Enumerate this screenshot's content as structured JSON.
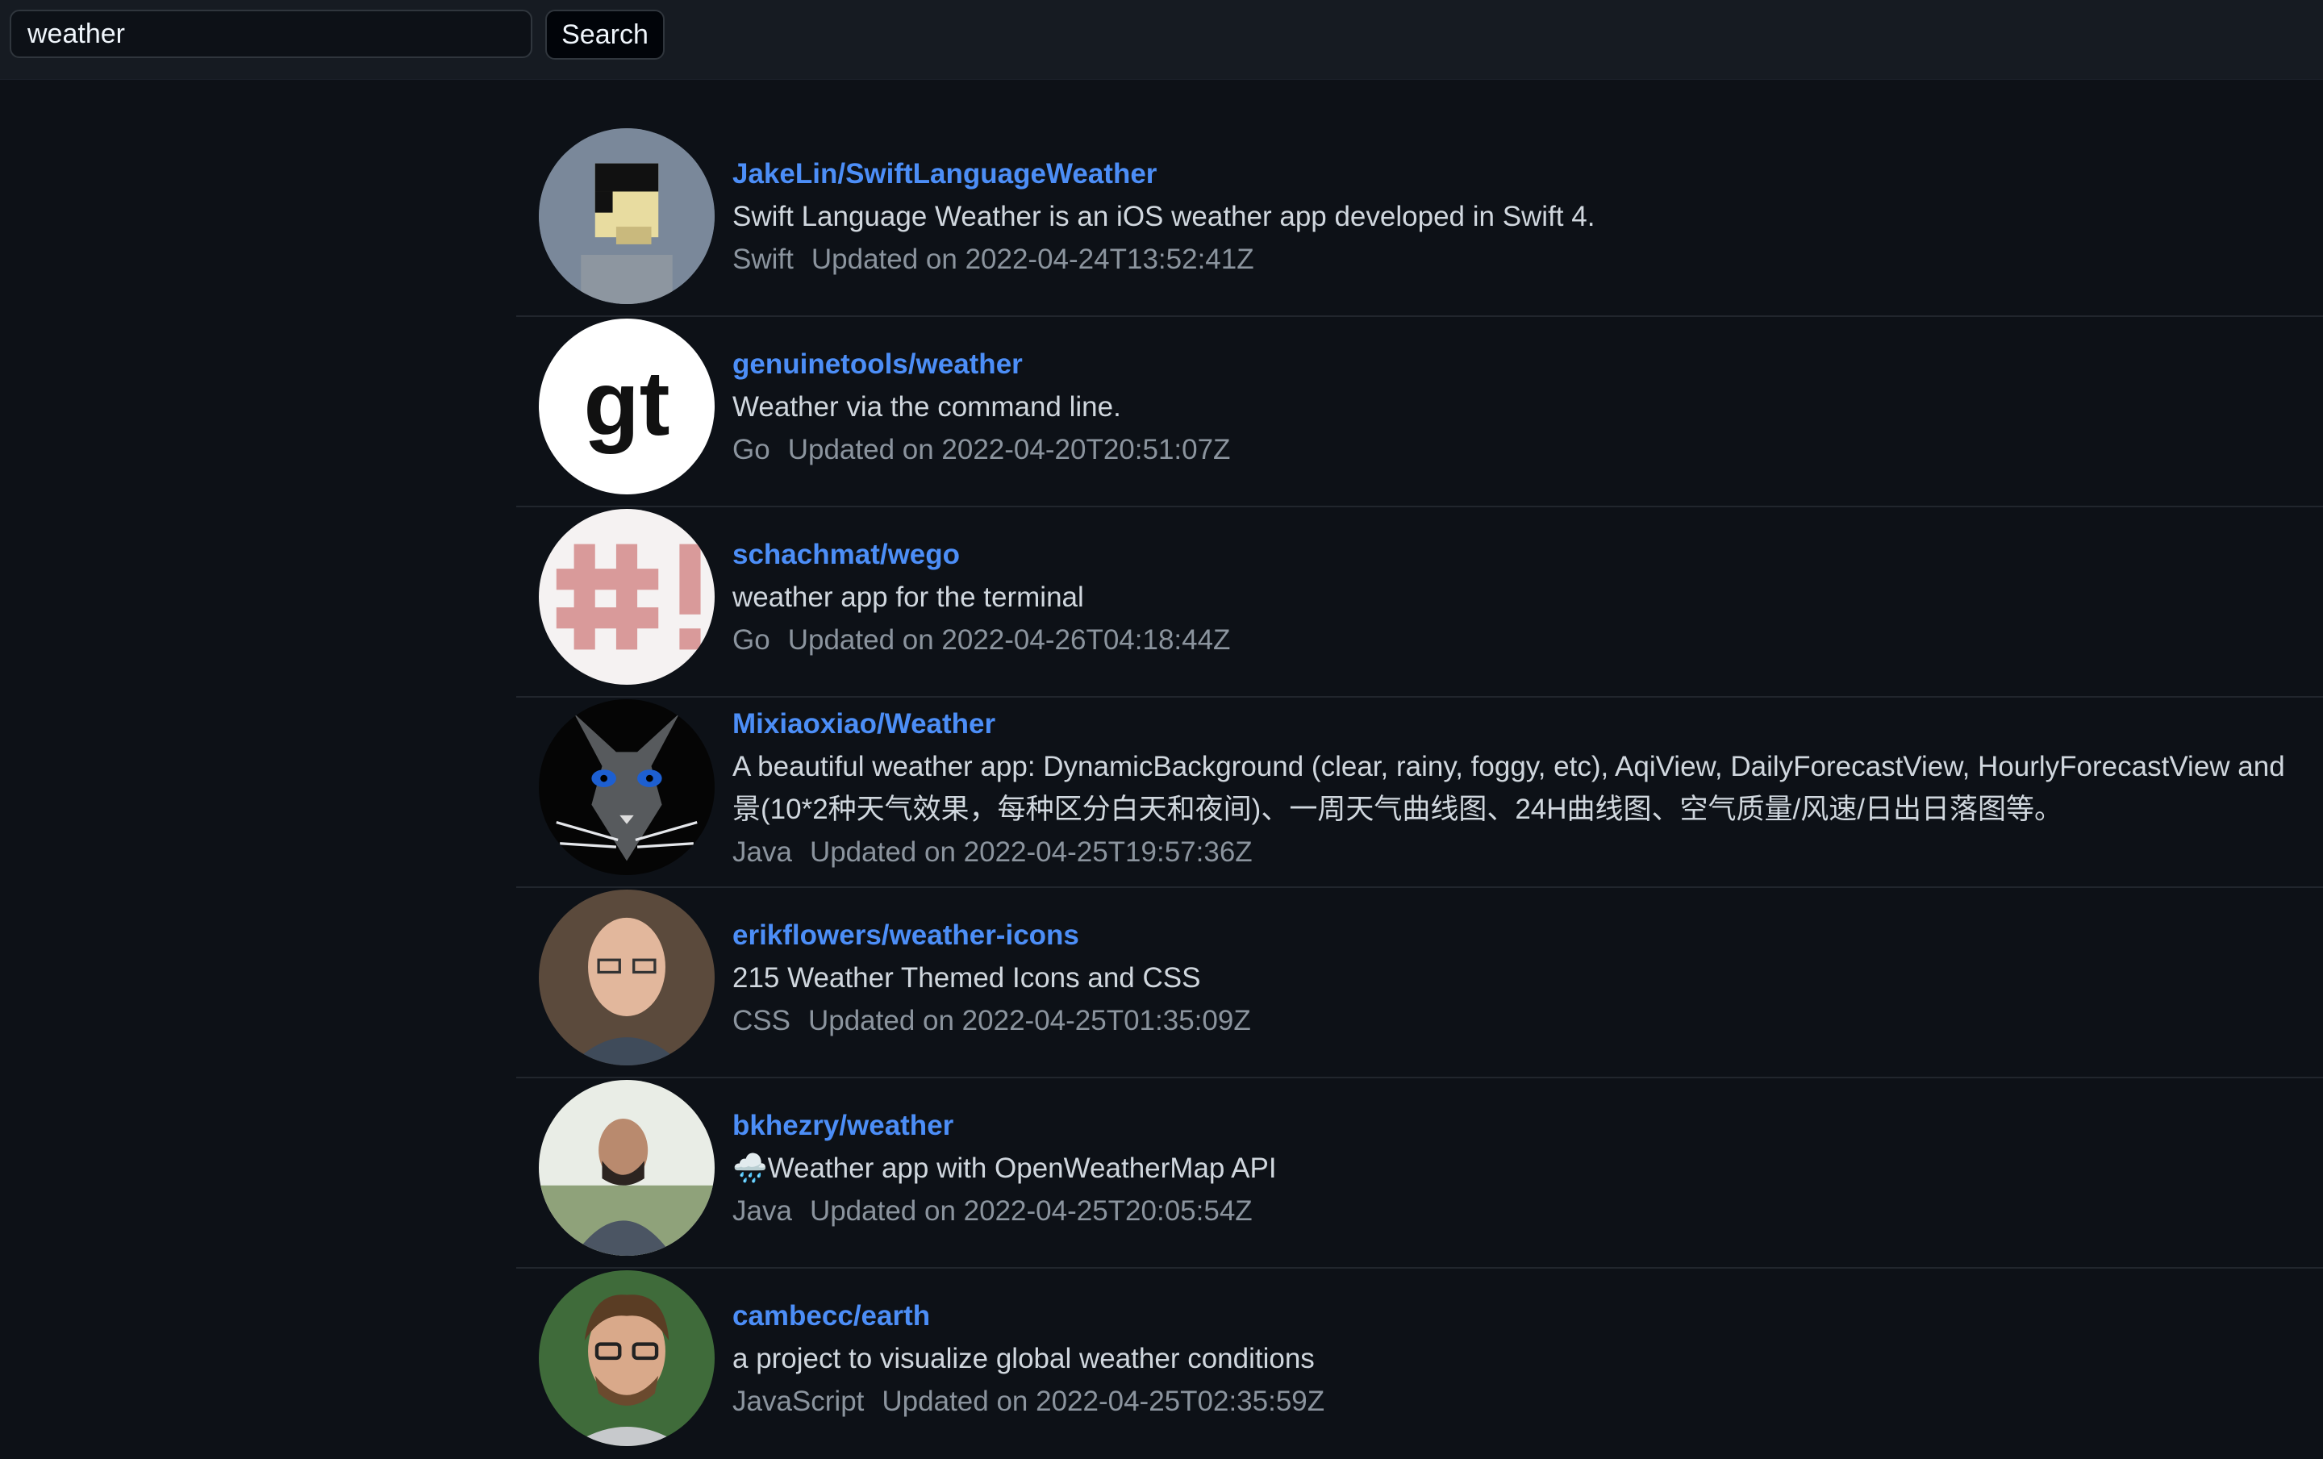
{
  "search": {
    "value": "weather",
    "button_label": "Search"
  },
  "results": [
    {
      "name": "JakeLin/SwiftLanguageWeather",
      "description": "Swift Language Weather is an iOS weather app developed in Swift 4.",
      "language": "Swift",
      "updated": "Updated on 2022-04-24T13:52:41Z",
      "avatar": "pixel-person-avatar"
    },
    {
      "name": "genuinetools/weather",
      "description": "Weather via the command line.",
      "language": "Go",
      "updated": "Updated on 2022-04-20T20:51:07Z",
      "avatar": "gt-logo-avatar",
      "avatar_text": "gt"
    },
    {
      "name": "schachmat/wego",
      "description": "weather app for the terminal",
      "language": "Go",
      "updated": "Updated on 2022-04-26T04:18:44Z",
      "avatar": "hash-pattern-avatar"
    },
    {
      "name": "Mixiaoxiao/Weather",
      "description": "A beautiful weather app: DynamicBackground (clear, rainy, foggy, etc), AqiView, DailyForecastView, HourlyForecastView and\n景(10*2种天气效果，每种区分白天和夜间)、一周天气曲线图、24H曲线图、空气质量/风速/日出日落图等。",
      "language": "Java",
      "updated": "Updated on 2022-04-25T19:57:36Z",
      "avatar": "cat-photo-avatar"
    },
    {
      "name": "erikflowers/weather-icons",
      "description": "215 Weather Themed Icons and CSS",
      "language": "CSS",
      "updated": "Updated on 2022-04-25T01:35:09Z",
      "avatar": "person-photo-avatar"
    },
    {
      "name": "bkhezry/weather",
      "description": "🌧️Weather app with OpenWeatherMap API",
      "language": "Java",
      "updated": "Updated on 2022-04-25T20:05:54Z",
      "avatar": "person-photo-avatar"
    },
    {
      "name": "cambecc/earth",
      "description": "a project to visualize global weather conditions",
      "language": "JavaScript",
      "updated": "Updated on 2022-04-25T02:35:59Z",
      "avatar": "person-photo-avatar"
    }
  ],
  "colors": {
    "background": "#0d1117",
    "topbar": "#161b22",
    "link": "#4c8ef7",
    "muted": "#8b949e"
  }
}
